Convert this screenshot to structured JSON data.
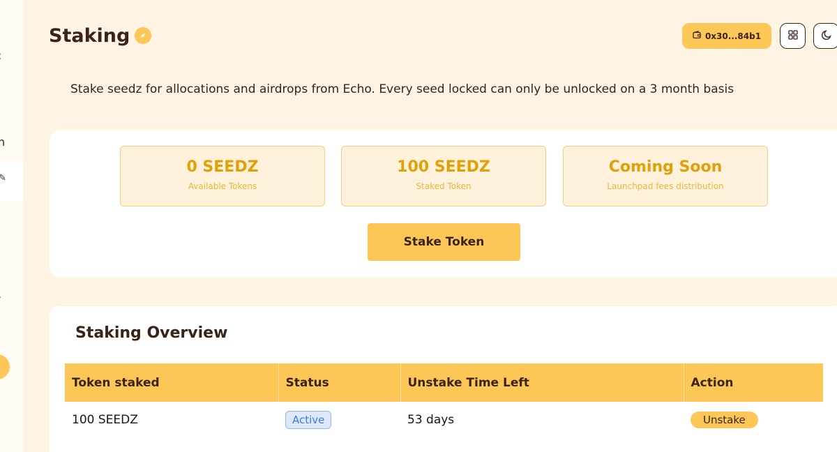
{
  "header": {
    "title": "Staking",
    "title_icon": "compass-icon",
    "wallet_label": "0x30...84b1",
    "wallet_icon": "wallet-icon",
    "apps_icon": "grid-icon",
    "theme_icon": "moon-icon"
  },
  "description": "Stake seedz for allocations and airdrops from Echo. Every seed locked can only be unlocked on a 3 month basis",
  "stats": [
    {
      "value": "0 SEEDZ",
      "label": "Available Tokens"
    },
    {
      "value": "100 SEEDZ",
      "label": "Staked Token"
    },
    {
      "value": "Coming Soon",
      "label": "Launchpad fees distribution"
    }
  ],
  "stake_button": "Stake Token",
  "overview": {
    "title": "Staking Overview",
    "columns": [
      "Token staked",
      "Status",
      "Unstake Time Left",
      "Action"
    ],
    "rows": [
      {
        "token": "100 SEEDZ",
        "status": "Active",
        "time_left": "53 days",
        "action": "Unstake"
      }
    ]
  },
  "colors": {
    "background": "#fef4e3",
    "accent": "#fdc758",
    "stat_value": "#e0a008",
    "text": "#3a2418",
    "status_active": "#3f78d8"
  }
}
